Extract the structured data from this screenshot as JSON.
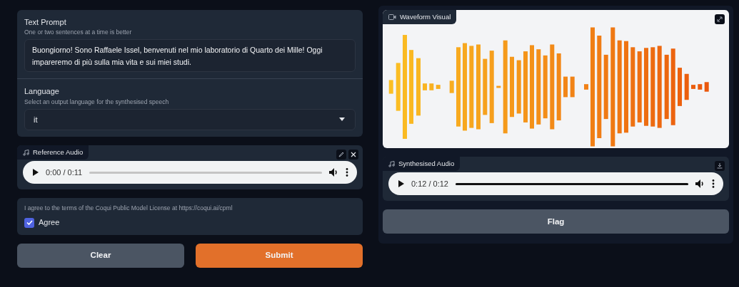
{
  "text_prompt": {
    "label": "Text Prompt",
    "info": "One or two sentences at a time is better",
    "value": "Buongiorno! Sono Raffaele Issel, benvenuti nel mio laboratorio di Quarto dei Mille! Oggi impareremo di più sulla mia vita e sui miei studi."
  },
  "language": {
    "label": "Language",
    "info": "Select an output language for the synthesised speech",
    "value": "it"
  },
  "reference_audio": {
    "label": "Reference Audio",
    "time": "0:00 / 0:11",
    "level": 0
  },
  "license": {
    "info": "I agree to the terms of the Coqui Public Model License at https://coqui.ai/cpml",
    "checkbox_label": "Agree",
    "checked": true
  },
  "buttons": [
    {
      "label": "Clear",
      "kind": "secondary"
    },
    {
      "label": "Submit",
      "kind": "primary"
    }
  ],
  "waveform": {
    "label": "Waveform Visual"
  },
  "synthesised_audio": {
    "label": "Synthesised Audio",
    "time": "0:12 / 0:12",
    "level": 1
  },
  "flag_button": {
    "label": "Flag"
  }
}
